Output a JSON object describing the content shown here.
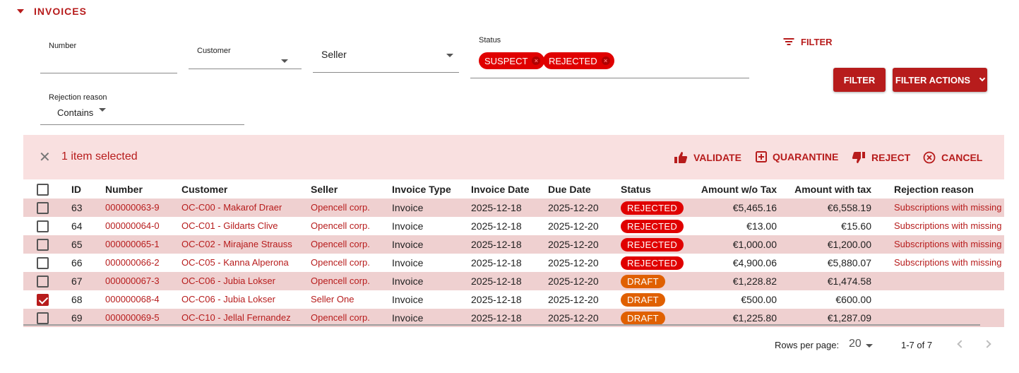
{
  "section": {
    "title": "INVOICES"
  },
  "filters": {
    "number_label": "Number",
    "customer_label": "Customer",
    "seller_label": "Seller",
    "status_label": "Status",
    "status_chips": [
      "SUSPECT",
      "REJECTED"
    ],
    "rejection_label": "Rejection reason",
    "rejection_value": "Contains",
    "filter_link": "FILTER",
    "filter_button": "FILTER",
    "filter_actions_button": "FILTER ACTIONS"
  },
  "selection": {
    "text": "1 item selected",
    "actions": [
      "VALIDATE",
      "QUARANTINE",
      "REJECT",
      "CANCEL"
    ]
  },
  "table": {
    "headers": [
      "ID",
      "Number",
      "Customer",
      "Seller",
      "Invoice Type",
      "Invoice Date",
      "Due Date",
      "Status",
      "Amount w/o Tax",
      "Amount with tax",
      "Rejection reason"
    ],
    "rows": [
      {
        "id": "63",
        "number": "000000063-9",
        "customer": "OC-C00 - Makarof Draer",
        "seller": "Opencell corp.",
        "type": "Invoice",
        "invoice_date": "2025-12-18",
        "due_date": "2025-12-20",
        "status": "REJECTED",
        "amount_wo_tax": "€5,465.16",
        "amount_with_tax": "€6,558.19",
        "rejection": "Subscriptions with missing",
        "checked": false
      },
      {
        "id": "64",
        "number": "000000064-0",
        "customer": "OC-C01 - Gildarts Clive",
        "seller": "Opencell corp.",
        "type": "Invoice",
        "invoice_date": "2025-12-18",
        "due_date": "2025-12-20",
        "status": "REJECTED",
        "amount_wo_tax": "€13.00",
        "amount_with_tax": "€15.60",
        "rejection": "Subscriptions with missing",
        "checked": false
      },
      {
        "id": "65",
        "number": "000000065-1",
        "customer": "OC-C02 - Mirajane Strauss",
        "seller": "Opencell corp.",
        "type": "Invoice",
        "invoice_date": "2025-12-18",
        "due_date": "2025-12-20",
        "status": "REJECTED",
        "amount_wo_tax": "€1,000.00",
        "amount_with_tax": "€1,200.00",
        "rejection": "Subscriptions with missing",
        "checked": false
      },
      {
        "id": "66",
        "number": "000000066-2",
        "customer": "OC-C05 - Kanna Alperona",
        "seller": "Opencell corp.",
        "type": "Invoice",
        "invoice_date": "2025-12-18",
        "due_date": "2025-12-20",
        "status": "REJECTED",
        "amount_wo_tax": "€4,900.06",
        "amount_with_tax": "€5,880.07",
        "rejection": "Subscriptions with missing",
        "checked": false
      },
      {
        "id": "67",
        "number": "000000067-3",
        "customer": "OC-C06 - Jubia Lokser",
        "seller": "Opencell corp.",
        "type": "Invoice",
        "invoice_date": "2025-12-18",
        "due_date": "2025-12-20",
        "status": "DRAFT",
        "amount_wo_tax": "€1,228.82",
        "amount_with_tax": "€1,474.58",
        "rejection": "",
        "checked": false
      },
      {
        "id": "68",
        "number": "000000068-4",
        "customer": "OC-C06 - Jubia Lokser",
        "seller": "Seller One",
        "type": "Invoice",
        "invoice_date": "2025-12-18",
        "due_date": "2025-12-20",
        "status": "DRAFT",
        "amount_wo_tax": "€500.00",
        "amount_with_tax": "€600.00",
        "rejection": "",
        "checked": true
      },
      {
        "id": "69",
        "number": "000000069-5",
        "customer": "OC-C10 - Jellal Fernandez",
        "seller": "Opencell corp.",
        "type": "Invoice",
        "invoice_date": "2025-12-18",
        "due_date": "2025-12-20",
        "status": "DRAFT",
        "amount_wo_tax": "€1,225.80",
        "amount_with_tax": "€1,287.09",
        "rejection": "",
        "checked": false
      }
    ]
  },
  "pagination": {
    "rows_label": "Rows per page:",
    "rows_value": "20",
    "range": "1-7 of 7"
  },
  "colors": {
    "accent": "#b71c1c",
    "rejected": "#e00000",
    "draft": "#e06000",
    "selection_bg": "#f9e0e0",
    "row_alt": "#efd0d0"
  }
}
